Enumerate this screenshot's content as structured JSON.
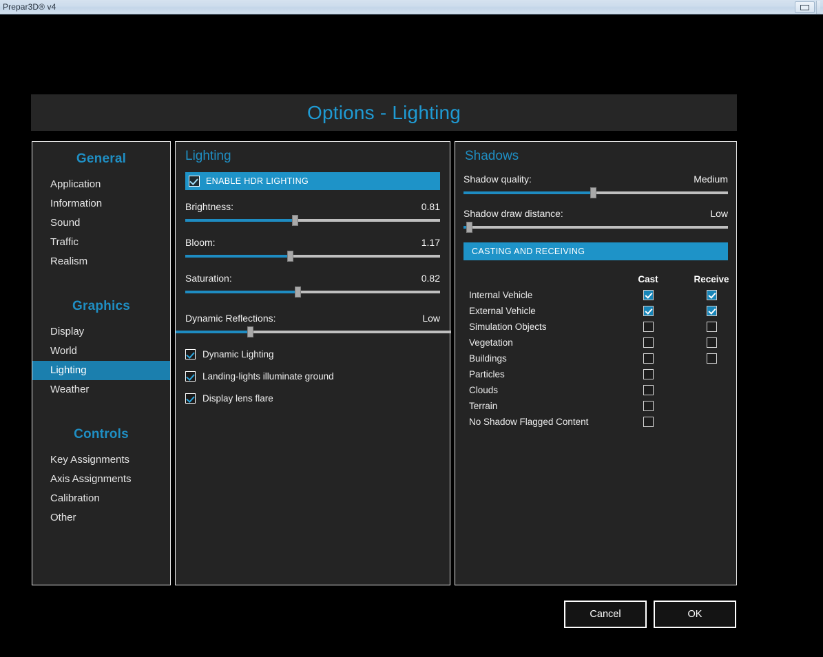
{
  "window": {
    "title": "Prepar3D® v4",
    "minimize_label": "minimize-box"
  },
  "dialog": {
    "title": "Options - Lighting"
  },
  "sidebar": {
    "groups": [
      {
        "title": "General",
        "items": [
          {
            "label": "Application",
            "selected": false
          },
          {
            "label": "Information",
            "selected": false
          },
          {
            "label": "Sound",
            "selected": false
          },
          {
            "label": "Traffic",
            "selected": false
          },
          {
            "label": "Realism",
            "selected": false
          }
        ]
      },
      {
        "title": "Graphics",
        "items": [
          {
            "label": "Display",
            "selected": false
          },
          {
            "label": "World",
            "selected": false
          },
          {
            "label": "Lighting",
            "selected": true
          },
          {
            "label": "Weather",
            "selected": false
          }
        ]
      },
      {
        "title": "Controls",
        "items": [
          {
            "label": "Key Assignments",
            "selected": false
          },
          {
            "label": "Axis Assignments",
            "selected": false
          },
          {
            "label": "Calibration",
            "selected": false
          },
          {
            "label": "Other",
            "selected": false
          }
        ]
      }
    ]
  },
  "lighting": {
    "panel_title": "Lighting",
    "hdr_banner": {
      "label": "ENABLE HDR LIGHTING",
      "checked": true
    },
    "sliders": [
      {
        "label": "Brightness:",
        "value": "0.81",
        "percent": 43
      },
      {
        "label": "Bloom:",
        "value": "1.17",
        "percent": 41
      },
      {
        "label": "Saturation:",
        "value": "0.82",
        "percent": 44
      }
    ],
    "dynamic_reflections": {
      "label": "Dynamic Reflections:",
      "value": "Low",
      "percent": 27
    },
    "checkboxes": [
      {
        "label": "Dynamic Lighting",
        "checked": true
      },
      {
        "label": "Landing-lights illuminate ground",
        "checked": true
      },
      {
        "label": "Display lens flare",
        "checked": true
      }
    ]
  },
  "shadows": {
    "panel_title": "Shadows",
    "sliders": [
      {
        "label": "Shadow quality:",
        "value": "Medium",
        "percent": 49
      },
      {
        "label": "Shadow draw distance:",
        "value": "Low",
        "percent": 2
      }
    ],
    "casting_banner": "CASTING AND RECEIVING",
    "columns": [
      "Cast",
      "Receive"
    ],
    "rows": [
      {
        "name": "Internal Vehicle",
        "cast": "checked",
        "receive": "checked"
      },
      {
        "name": "External Vehicle",
        "cast": "checked",
        "receive": "checked"
      },
      {
        "name": "Simulation Objects",
        "cast": "unchecked",
        "receive": "unchecked"
      },
      {
        "name": "Vegetation",
        "cast": "unchecked",
        "receive": "unchecked"
      },
      {
        "name": "Buildings",
        "cast": "unchecked",
        "receive": "unchecked"
      },
      {
        "name": "Particles",
        "cast": "unchecked",
        "receive": "none"
      },
      {
        "name": "Clouds",
        "cast": "unchecked",
        "receive": "none"
      },
      {
        "name": "Terrain",
        "cast": "unchecked",
        "receive": "none"
      },
      {
        "name": "No Shadow Flagged Content",
        "cast": "unchecked",
        "receive": "none"
      }
    ]
  },
  "footer": {
    "cancel_label": "Cancel",
    "ok_label": "OK"
  },
  "colors": {
    "accent": "#1e93c8",
    "accent_title": "#1f9bd4",
    "selected_nav": "#1b7fae",
    "panel_bg": "#242424",
    "app_bg": "#000000"
  }
}
